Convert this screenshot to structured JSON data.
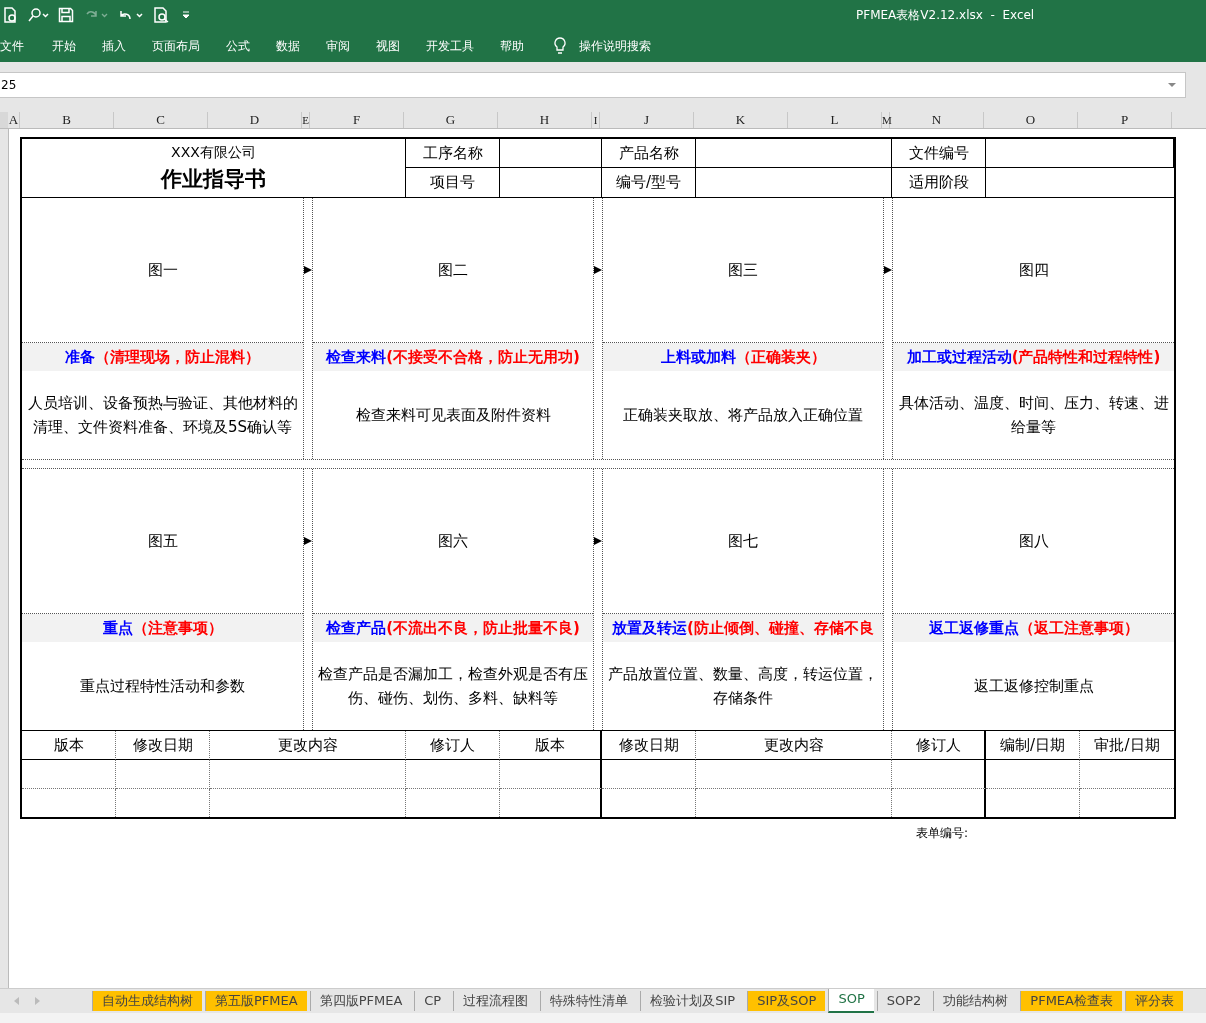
{
  "window": {
    "title": "PFMEA表格V2.12.xlsx  -  Excel"
  },
  "ribbon_tabs": [
    {
      "label": "文件"
    },
    {
      "label": "开始"
    },
    {
      "label": "插入"
    },
    {
      "label": "页面布局"
    },
    {
      "label": "公式"
    },
    {
      "label": "数据"
    },
    {
      "label": "审阅"
    },
    {
      "label": "视图"
    },
    {
      "label": "开发工具"
    },
    {
      "label": "帮助"
    }
  ],
  "tell_me": {
    "label": "操作说明搜索"
  },
  "formula_bar": {
    "name_box": "25"
  },
  "columns": [
    "A",
    "B",
    "C",
    "D",
    "E",
    "F",
    "G",
    "H",
    "I",
    "J",
    "K",
    "L",
    "M",
    "N",
    "O",
    "P"
  ],
  "form": {
    "company": "XXX有限公司",
    "title": "作业指导书",
    "header_fields": [
      {
        "label": "工序名称"
      },
      {
        "label": "产品名称"
      },
      {
        "label": "文件编号"
      },
      {
        "label": "项目号"
      },
      {
        "label": "编号/型号"
      },
      {
        "label": "适用阶段"
      }
    ],
    "step_rows": [
      {
        "steps": [
          {
            "picture": "图一",
            "title": "准备",
            "note": "（清理现场，防止混料）",
            "description": "人员培训、设备预热与验证、其他材料的清理、文件资料准备、环境及5S确认等",
            "arrow_after": true
          },
          {
            "picture": "图二",
            "title": "检查来料",
            "note": "(不接受不合格，防止无用功)",
            "description": "检查来料可见表面及附件资料",
            "arrow_after": true
          },
          {
            "picture": "图三",
            "title": "上料或加料",
            "note": "（正确装夹）",
            "description": "正确装夹取放、将产品放入正确位置",
            "arrow_after": true
          },
          {
            "picture": "图四",
            "title": "加工或过程活动",
            "note": "(产品特性和过程特性)",
            "description": "具体活动、温度、时间、压力、转速、进给量等"
          }
        ]
      },
      {
        "steps": [
          {
            "picture": "图五",
            "title": "重点",
            "note": "（注意事项）",
            "description": "重点过程特性活动和参数",
            "arrow_after": true
          },
          {
            "picture": "图六",
            "title": "检查产品",
            "note": "(不流出不良，防止批量不良)",
            "description": "检查产品是否漏加工，检查外观是否有压伤、碰伤、划伤、多料、缺料等",
            "arrow_after": true
          },
          {
            "picture": "图七",
            "title": "放置及转运",
            "note": "(防止倾倒、碰撞、存储不良",
            "description": "产品放置位置、数量、高度，转运位置，存储条件",
            "arrow_after": false
          },
          {
            "picture": "图八",
            "title": "返工返修重点",
            "note": "（返工注意事项）",
            "description": "返工返修控制重点"
          }
        ]
      }
    ],
    "revision_columns": [
      "版本",
      "修改日期",
      "更改内容",
      "修订人",
      "版本",
      "修改日期",
      "更改内容",
      "修订人",
      "编制/日期",
      "审批/日期"
    ],
    "form_number_label": "表单编号:"
  },
  "sheet_tabs": [
    {
      "label": "自动生成结构树",
      "color": "#ffc000",
      "selected": false
    },
    {
      "label": "第五版PFMEA",
      "color": "#ffc000",
      "selected": false
    },
    {
      "label": "第四版PFMEA",
      "selected": false
    },
    {
      "label": "CP",
      "selected": false
    },
    {
      "label": "过程流程图",
      "selected": false
    },
    {
      "label": "特殊特性清单",
      "selected": false
    },
    {
      "label": "检验计划及SIP",
      "selected": false
    },
    {
      "label": "SIP及SOP",
      "color": "#ffc000",
      "selected": false
    },
    {
      "label": "SOP",
      "selected": true
    },
    {
      "label": "SOP2",
      "selected": false
    },
    {
      "label": "功能结构树",
      "selected": false
    },
    {
      "label": "PFMEA检查表",
      "color": "#ffc000",
      "selected": false
    },
    {
      "label": "评分表",
      "color": "#ffc000",
      "selected": false
    }
  ]
}
